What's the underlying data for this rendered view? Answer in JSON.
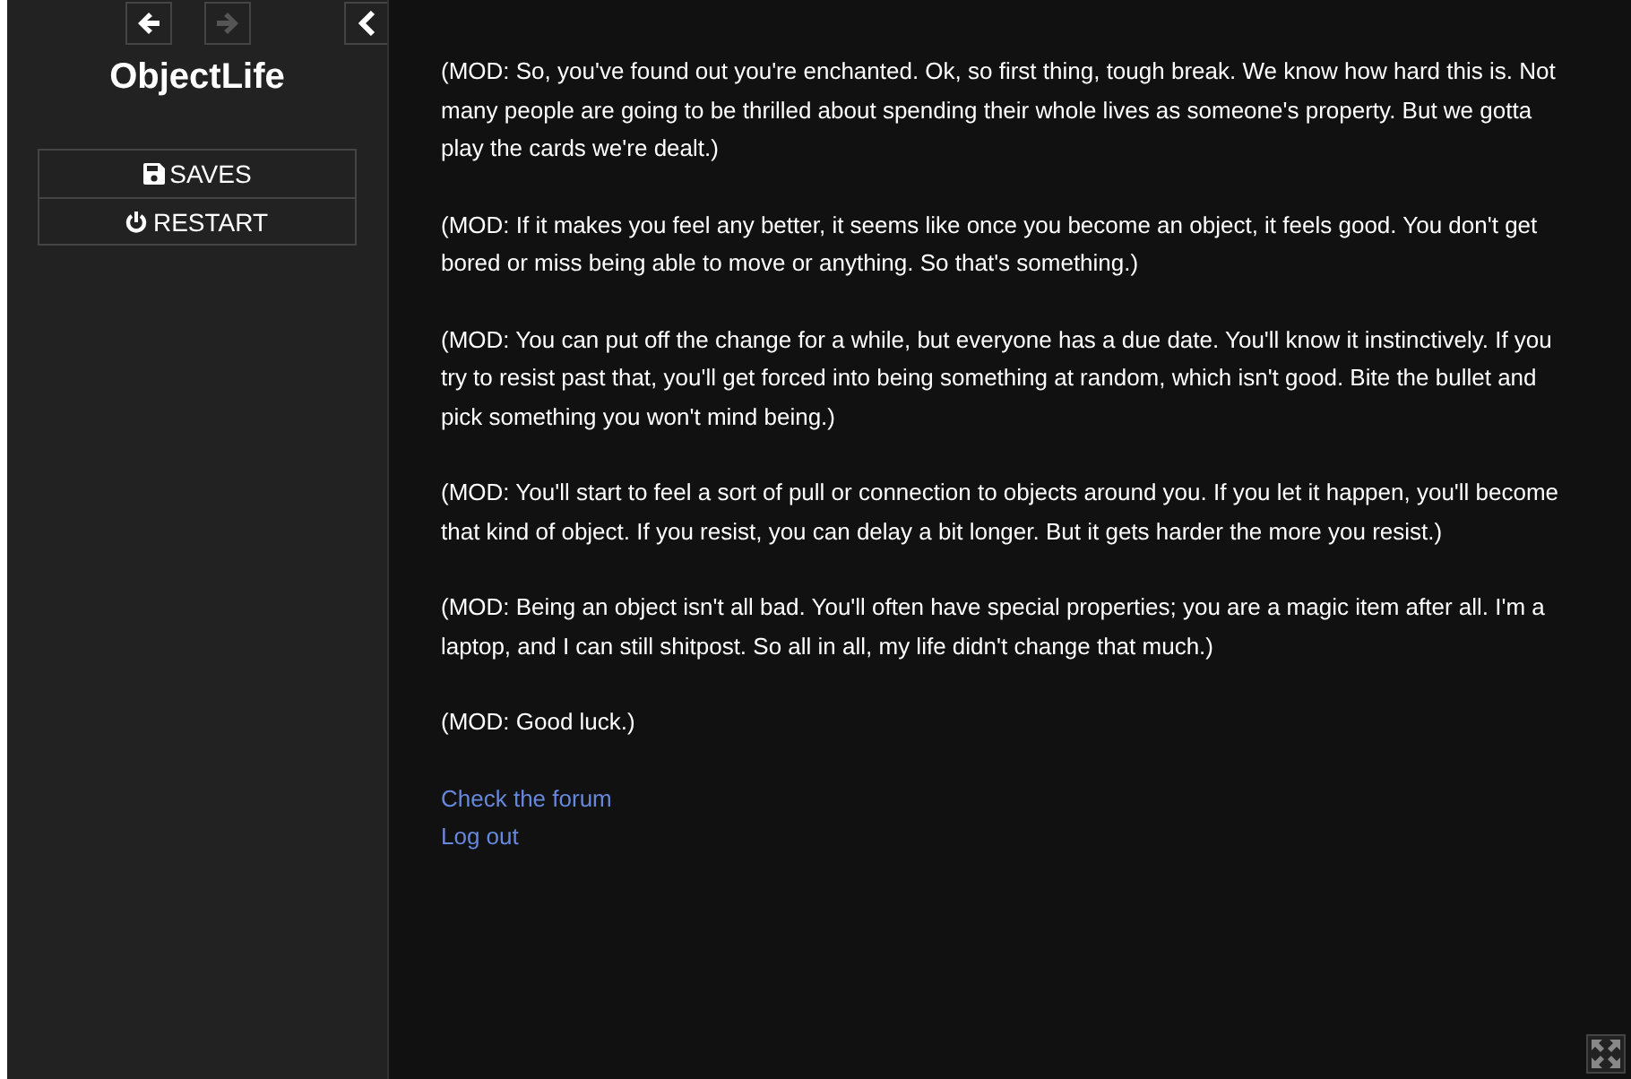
{
  "sidebar": {
    "history": [
      {
        "kind": "back",
        "disabled": false
      },
      {
        "kind": "forward",
        "disabled": true
      }
    ],
    "title": "ObjectLife",
    "menu": [
      {
        "kind": "saves",
        "label": "SAVES"
      },
      {
        "kind": "restart",
        "label": "RESTART"
      }
    ]
  },
  "passage": {
    "paragraphs": [
      "(MOD: So, you've found out you're enchanted. Ok, so first thing, tough break. We know how hard this is. Not many people are going to be thrilled about spending their whole lives as someone's property. But we gotta play the cards we're dealt.)",
      "(MOD: If it makes you feel any better, it seems like once you become an object, it feels good. You don't get bored or miss being able to move or anything. So that's something.)",
      "(MOD: You can put off the change for a while, but everyone has a due date. You'll know it instinctively. If you try to resist past that, you'll get forced into being something at random, which isn't good. Bite the bullet and pick something you won't mind being.)",
      "(MOD: You'll start to feel a sort of pull or connection to objects around you. If you let it happen, you'll become that kind of object. If you resist, you can delay a bit longer. But it gets harder the more you resist.)",
      "(MOD: Being an object isn't all bad. You'll often have special properties; you are a magic item after all. I'm a laptop, and I can still shitpost. So all in all, my life didn't change that much.)",
      "(MOD: Good luck.)"
    ],
    "links": [
      "Check the forum",
      "Log out"
    ]
  }
}
